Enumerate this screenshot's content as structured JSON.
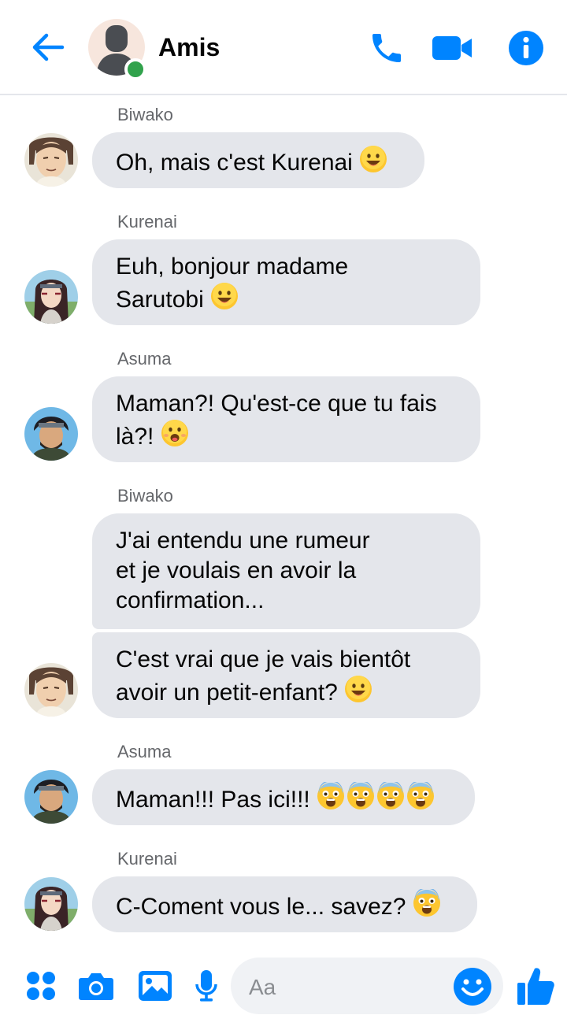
{
  "header": {
    "title": "Amis",
    "status": "online",
    "accent_color": "#0084ff",
    "icons": [
      "back-arrow-icon",
      "phone-icon",
      "video-camera-icon",
      "info-icon"
    ]
  },
  "messages": [
    {
      "sender": "Biwako",
      "lines": [
        "Oh, mais c'est Kurenai"
      ],
      "emoji": "smile",
      "avatar": "biwako"
    },
    {
      "sender": "Kurenai",
      "lines": [
        "Euh, bonjour madame",
        "Sarutobi"
      ],
      "emoji": "smile",
      "avatar": "kurenai"
    },
    {
      "sender": "Asuma",
      "lines": [
        "Maman?! Qu'est-ce que tu fais",
        "là?!"
      ],
      "emoji": "surprised",
      "avatar": "asuma"
    },
    {
      "sender": "Biwako",
      "lines": [
        "J'ai entendu une rumeur",
        "et je voulais en avoir la",
        "confirmation..."
      ],
      "emoji": null,
      "avatar": null
    },
    {
      "sender": "",
      "lines": [
        "C'est vrai que je vais bientôt",
        "avoir un petit-enfant?"
      ],
      "emoji": "smile",
      "avatar": "biwako"
    },
    {
      "sender": "Asuma",
      "lines": [
        "Maman!!! Pas ici!!!"
      ],
      "emoji": "screaming x4",
      "avatar": "asuma"
    },
    {
      "sender": "Kurenai",
      "lines": [
        "C-Coment vous le... savez?"
      ],
      "emoji": "screaming",
      "avatar": "kurenai"
    }
  ],
  "composer": {
    "placeholder": "Aa",
    "icons": [
      "apps-grid-icon",
      "camera-icon",
      "gallery-icon",
      "microphone-icon",
      "emoji-icon",
      "thumbs-up-icon"
    ]
  },
  "colors": {
    "bubble": "#e4e6eb",
    "accent": "#0084ff",
    "online": "#31a24c"
  }
}
